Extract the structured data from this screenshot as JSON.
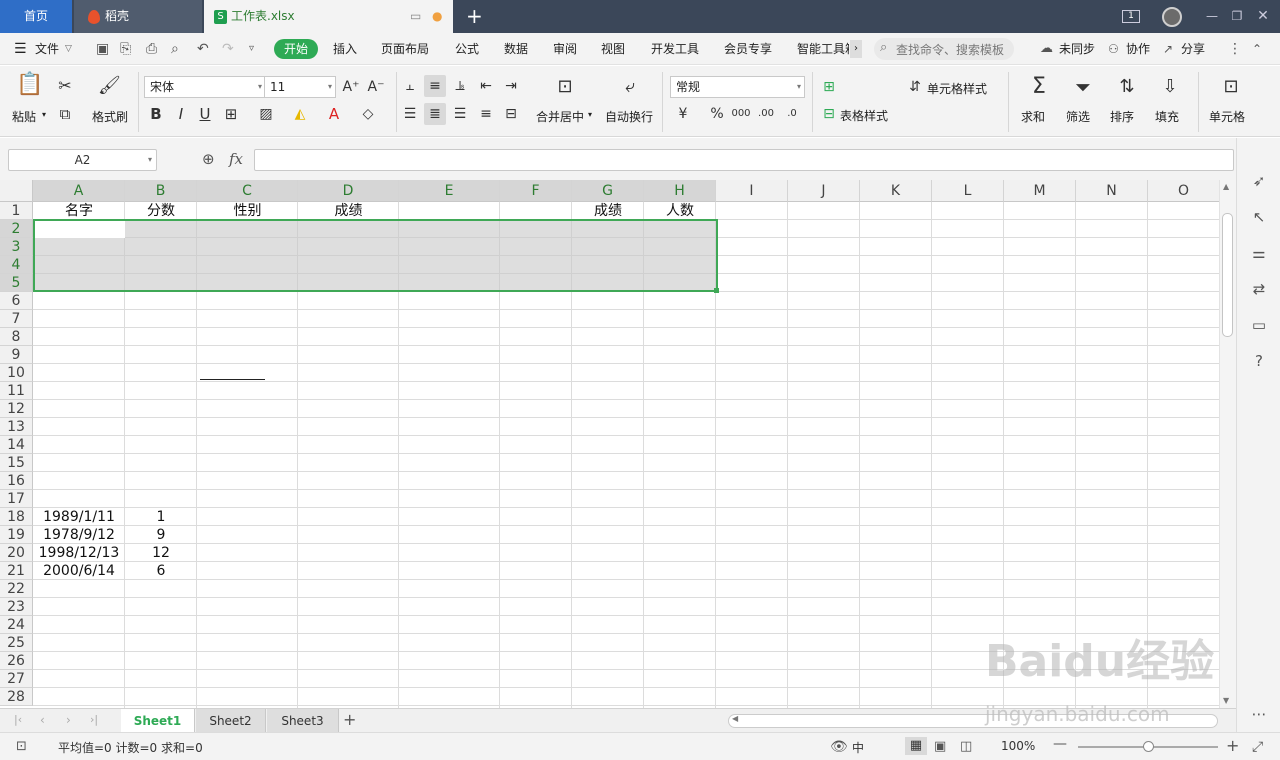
{
  "tabs": {
    "home": "首页",
    "docer": "稻壳",
    "doc": "工作表.xlsx",
    "new_tab": "+",
    "page_indicator": "1"
  },
  "menu": {
    "file": "文件",
    "items": [
      "开始",
      "插入",
      "页面布局",
      "公式",
      "数据",
      "审阅",
      "视图",
      "开发工具",
      "会员专享",
      "智能工具箱"
    ],
    "search_placeholder": "查找命令、搜索模板",
    "unsynced": "未同步",
    "collab": "协作",
    "share": "分享"
  },
  "toolbar": {
    "paste": "粘贴",
    "format_painter": "格式刷",
    "font_name": "宋体",
    "font_size": "11",
    "merge_center": "合并居中",
    "wrap_text": "自动换行",
    "number_format": "常规",
    "cell_style": "单元格样式",
    "table_style": "表格样式",
    "sum": "求和",
    "filter": "筛选",
    "sort": "排序",
    "fill": "填充",
    "cells": "单元格",
    "currency_symbol": "¥",
    "percent_symbol": "%",
    "thousands": "000",
    "inc_decimal": ".00",
    "dec_decimal": ".0"
  },
  "formula_bar": {
    "name_box": "A2",
    "fx": "fx",
    "content": ""
  },
  "grid": {
    "columns": [
      "A",
      "B",
      "C",
      "D",
      "E",
      "F",
      "G",
      "H",
      "I",
      "J",
      "K",
      "L",
      "M",
      "N",
      "O"
    ],
    "active_columns": [
      "A",
      "B",
      "C",
      "D",
      "E",
      "F",
      "G",
      "H"
    ],
    "rows": [
      "1",
      "2",
      "3",
      "4",
      "5",
      "6",
      "7",
      "8",
      "9",
      "10",
      "11",
      "12",
      "13",
      "14",
      "15",
      "16",
      "17",
      "18",
      "19",
      "20",
      "21",
      "22",
      "23",
      "24",
      "25",
      "26",
      "27",
      "28"
    ],
    "active_rows": [
      "2",
      "3",
      "4",
      "5"
    ],
    "header_row": {
      "A": "名字",
      "B": "分数",
      "C": "性别",
      "D": "成绩",
      "G": "成绩",
      "H": "人数"
    },
    "data_rows": [
      {
        "row": "18",
        "A": "1989/1/11",
        "B": "1"
      },
      {
        "row": "19",
        "A": "1978/9/12",
        "B": "9"
      },
      {
        "row": "20",
        "A": "1998/12/13",
        "B": "12"
      },
      {
        "row": "21",
        "A": "2000/6/14",
        "B": "6"
      }
    ]
  },
  "sheets": {
    "tabs": [
      "Sheet1",
      "Sheet2",
      "Sheet3"
    ],
    "active": "Sheet1",
    "add": "+"
  },
  "status": {
    "summary": "平均值=0  计数=0  求和=0",
    "lang": "中",
    "zoom": "100%",
    "zoom_fraction": 0.5
  },
  "watermark": {
    "brand": "Baidu经验",
    "url": "jingyan.baidu.com"
  },
  "colors": {
    "accent": "#2eaa55",
    "selection_border": "#3fa856",
    "titlebar": "#3b4759",
    "home_tab": "#2f6ec7"
  }
}
